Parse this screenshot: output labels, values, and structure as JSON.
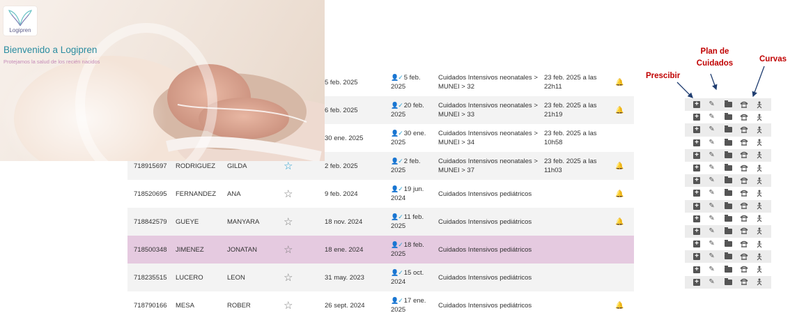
{
  "hero": {
    "logo_text": "Logipren",
    "welcome": "Bienvenido a Logipren",
    "tagline": "Protejamos la salud de los recién nacidos"
  },
  "colors": {
    "selected_row": "#e5cae0",
    "annotation": "#c00000",
    "admission_icon": "#2a9fd0",
    "alert_icon": "#f2c40f",
    "welcome_text": "#2a8ca0",
    "tagline_text": "#c48bb7"
  },
  "patients": [
    {
      "id": "",
      "last_name": "",
      "first_name": "",
      "star": "",
      "birth": "5 feb. 2025",
      "admission": "5 feb. 2025",
      "unit": "Cuidados Intensivos neonatales > MUNEI > 32",
      "discharge": "23 feb. 2025 a las 22h11",
      "alert": true
    },
    {
      "id": "",
      "last_name": "",
      "first_name": "",
      "star": "",
      "birth": "6 feb. 2025",
      "admission": "20 feb. 2025",
      "unit": "Cuidados Intensivos neonatales > MUNEI > 33",
      "discharge": "23 feb. 2025 a las 21h19",
      "alert": true
    },
    {
      "id": "",
      "last_name": "",
      "first_name": "",
      "star": "",
      "birth": "30 ene. 2025",
      "admission": "30 ene. 2025",
      "unit": "Cuidados Intensivos neonatales > MUNEI > 34",
      "discharge": "23 feb. 2025 a las 10h58",
      "alert": false
    },
    {
      "id": "718915697",
      "last_name": "RODRIGUEZ",
      "first_name": "GILDA",
      "star": "☆",
      "star_fav": true,
      "birth": "2 feb. 2025",
      "admission": "2 feb. 2025",
      "unit": "Cuidados Intensivos neonatales > MUNEI > 37",
      "discharge": "23 feb. 2025 a las 11h03",
      "alert": true
    },
    {
      "id": "718520695",
      "last_name": "FERNANDEZ",
      "first_name": "ANA",
      "star": "☆",
      "birth": "9 feb. 2024",
      "admission": "19 jun. 2024",
      "unit": "Cuidados Intensivos pediátricos",
      "discharge": "",
      "alert": true
    },
    {
      "id": "718842579",
      "last_name": "GUEYE",
      "first_name": "MANYARA",
      "star": "☆",
      "birth": "18 nov. 2024",
      "admission": "11 feb. 2025",
      "unit": "Cuidados Intensivos pediátricos",
      "discharge": "",
      "alert": true
    },
    {
      "id": "718500348",
      "last_name": "JIMENEZ",
      "first_name": "JONATAN",
      "star": "☆",
      "birth": "18 ene. 2024",
      "admission": "18 feb. 2025",
      "unit": "Cuidados Intensivos pediátricos",
      "discharge": "",
      "alert": false,
      "selected": true
    },
    {
      "id": "718235515",
      "last_name": "LUCERO",
      "first_name": "LEON",
      "star": "☆",
      "birth": "31 may. 2023",
      "admission": "15 oct. 2024",
      "unit": "Cuidados Intensivos pediátricos",
      "discharge": "",
      "alert": false
    },
    {
      "id": "718790166",
      "last_name": "MESA",
      "first_name": "ROBER",
      "star": "☆",
      "birth": "26 sept. 2024",
      "admission": "17 ene. 2025",
      "unit": "Cuidados Intensivos pediátricos",
      "discharge": "",
      "alert": true
    }
  ],
  "action_icons": [
    "plus-square-icon",
    "pencil-icon",
    "folder-user-icon",
    "incubator-icon",
    "growth-curve-icon"
  ],
  "action_rows": 15,
  "annotations": {
    "prescribe": "Prescibir",
    "plan": "Plan de Cuidados",
    "curves": "Curvas"
  }
}
